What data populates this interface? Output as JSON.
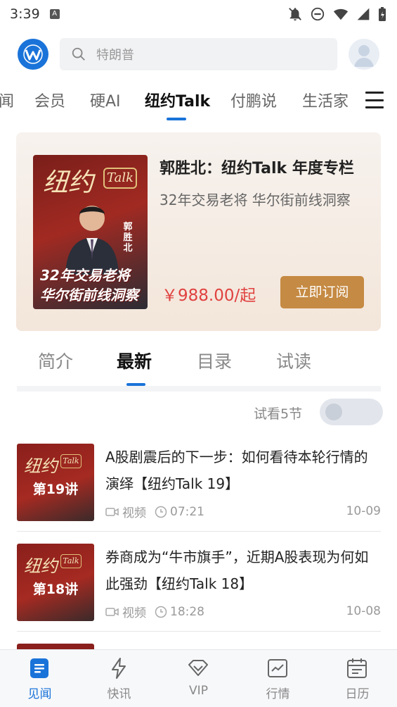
{
  "status_bar": {
    "time": "3:39"
  },
  "header": {
    "search_placeholder": "特朗普"
  },
  "channels": {
    "items": [
      "闻",
      "会员",
      "硬AI",
      "纽约Talk",
      "付鹏说",
      "生活家"
    ],
    "active": "纽约Talk"
  },
  "course": {
    "title": "郭胜北：纽约Talk  年度专栏",
    "subtitle": "32年交易老将 华尔街前线洞察",
    "price": "￥988.00/起",
    "subscribe_label": "立即订阅",
    "cover": {
      "brand": "纽约",
      "talk": "Talk",
      "name_tag": "郭胜北",
      "caption_line1": "32年交易老将",
      "caption_line2": "华尔街前线洞察"
    }
  },
  "sub_tabs": {
    "items": [
      "简介",
      "最新",
      "目录",
      "试读"
    ],
    "active": "最新"
  },
  "preview": {
    "label": "试看5节",
    "enabled": false
  },
  "episodes": [
    {
      "title": "A股剧震后的下一步：如何看待本轮行情的演绎【纽约Talk 19】",
      "type": "视频",
      "duration": "07:21",
      "date": "10-09",
      "thumb_brand": "纽约",
      "thumb_talk": "Talk",
      "thumb_lecture": "第19讲"
    },
    {
      "title": "券商成为“牛市旗手”，近期A股表现为何如此强劲【纽约Talk 18】",
      "type": "视频",
      "duration": "18:28",
      "date": "10-08",
      "thumb_brand": "纽约",
      "thumb_talk": "Talk",
      "thumb_lecture": "第18讲"
    }
  ],
  "bottom_nav": {
    "items": [
      {
        "label": "见闻",
        "icon": "news-icon"
      },
      {
        "label": "快讯",
        "icon": "flash-icon"
      },
      {
        "label": "VIP",
        "icon": "vip-icon"
      },
      {
        "label": "行情",
        "icon": "market-icon"
      },
      {
        "label": "日历",
        "icon": "calendar-icon"
      }
    ],
    "active": "见闻"
  },
  "colors": {
    "accent": "#1a73d9",
    "price": "#e0413f",
    "subscribe": "#c58a43"
  }
}
